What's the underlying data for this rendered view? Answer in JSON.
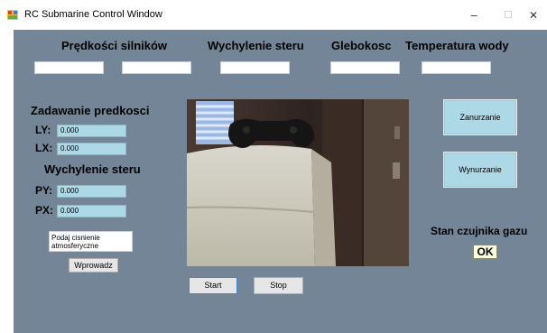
{
  "window": {
    "title": "RC Submarine Control Window",
    "minimize_glyph": "–",
    "maximize_glyph": "☐",
    "close_glyph": "✕"
  },
  "headers": {
    "motor_speeds": "Prędkości silników",
    "rudder_deflection": "Wychylenie steru",
    "depth": "Glebokosc",
    "water_temperature": "Temperatura wody"
  },
  "speed_setting": {
    "title": "Zadawanie predkosci",
    "ly_label": "LY:",
    "ly_value": "0.000",
    "lx_label": "LX:",
    "lx_value": "0.000"
  },
  "rudder": {
    "title": "Wychylenie steru",
    "py_label": "PY:",
    "py_value": "0.000",
    "px_label": "PX:",
    "px_value": "0.000"
  },
  "pressure": {
    "input_text": "Podaj cisnienie atmosferyczne",
    "submit_label": "Wprowadz"
  },
  "controls": {
    "start_label": "Start",
    "stop_label": "Stop",
    "dive_label": "Zanurzanie",
    "surface_label": "Wynurzanie"
  },
  "gas_sensor": {
    "title": "Stan czujnika gazu",
    "status": "OK"
  },
  "colors": {
    "client_bg": "#738597",
    "field_value_bg": "#add8e6"
  }
}
